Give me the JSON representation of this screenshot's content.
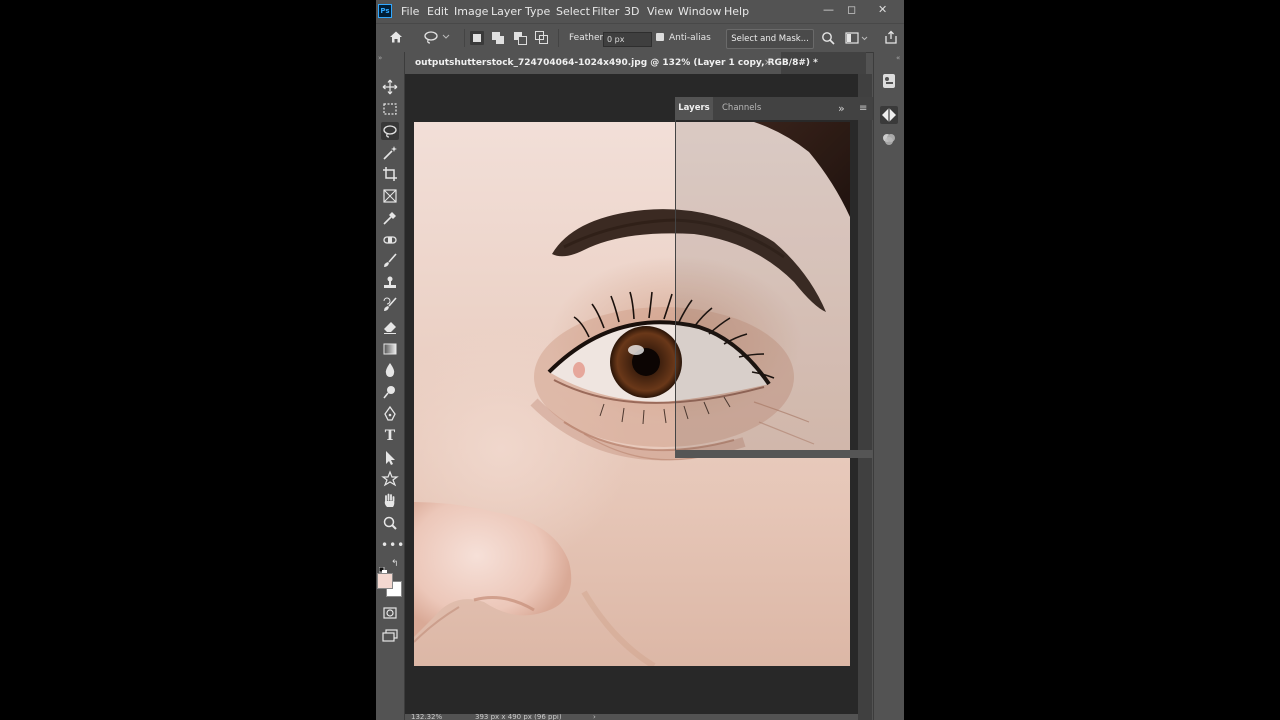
{
  "app": {
    "logo_text": "Ps"
  },
  "menu": [
    "File",
    "Edit",
    "Image",
    "Layer",
    "Type",
    "Select",
    "Filter",
    "3D",
    "View",
    "Window",
    "Help"
  ],
  "window_controls": {
    "minimize": "—",
    "restore": "◻",
    "close": "✕"
  },
  "options_bar": {
    "feather_label": "Feather:",
    "feather_value": "0 px",
    "antialias_label": "Anti-alias",
    "select_mask_label": "Select and Mask..."
  },
  "document": {
    "tab_title": "outputshutterstock_724704064-1024x490.jpg @ 132% (Layer 1 copy, RGB/8#) *",
    "tab_close": "×"
  },
  "panels": {
    "tabs": [
      "Layers",
      "Channels"
    ],
    "expand": "»",
    "menu": "≡"
  },
  "status": {
    "zoom": "132.32%",
    "dimensions": "393 px x 490 px (96 ppi)",
    "arrow": "›"
  },
  "colors": {
    "foreground": "#f3d8d0",
    "background": "#ffffff",
    "accent": "#31a8ff"
  },
  "icons": {
    "tools": [
      "move-icon",
      "marquee-icon",
      "lasso-icon",
      "magic-wand-icon",
      "crop-icon",
      "frame-icon",
      "eyedropper-icon",
      "spot-healing-icon",
      "brush-icon",
      "clone-stamp-icon",
      "history-brush-icon",
      "eraser-icon",
      "gradient-icon",
      "blur-icon",
      "dodge-icon",
      "pen-icon",
      "type-icon",
      "path-selection-icon",
      "shape-icon",
      "hand-icon",
      "zoom-icon",
      "more-tools-icon"
    ]
  }
}
